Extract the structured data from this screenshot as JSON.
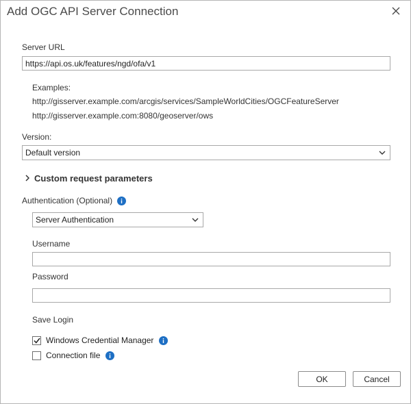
{
  "dialog": {
    "title": "Add OGC API Server Connection"
  },
  "server_url": {
    "label": "Server URL",
    "value": "https://api.os.uk/features/ngd/ofa/v1"
  },
  "examples": {
    "heading": "Examples:",
    "items": [
      "http://gisserver.example.com/arcgis/services/SampleWorldCities/OGCFeatureServer",
      "http://gisserver.example.com:8080/geoserver/ows"
    ]
  },
  "version": {
    "label": "Version:",
    "selected": "Default version"
  },
  "custom_params": {
    "label": "Custom request parameters"
  },
  "authentication": {
    "label": "Authentication (Optional)",
    "selected": "Server Authentication"
  },
  "username": {
    "label": "Username",
    "value": ""
  },
  "password": {
    "label": "Password",
    "value": ""
  },
  "save_login": {
    "label": "Save Login",
    "options": [
      {
        "label": "Windows Credential Manager",
        "checked": true
      },
      {
        "label": "Connection file",
        "checked": false
      }
    ]
  },
  "buttons": {
    "ok": "OK",
    "cancel": "Cancel"
  },
  "colors": {
    "info_icon": "#1e6fc4"
  },
  "icons": {
    "close": "close-icon",
    "dropdown": "chevron-down-icon",
    "expander": "chevron-right-icon",
    "info": "info-icon",
    "check": "checkmark-icon"
  }
}
